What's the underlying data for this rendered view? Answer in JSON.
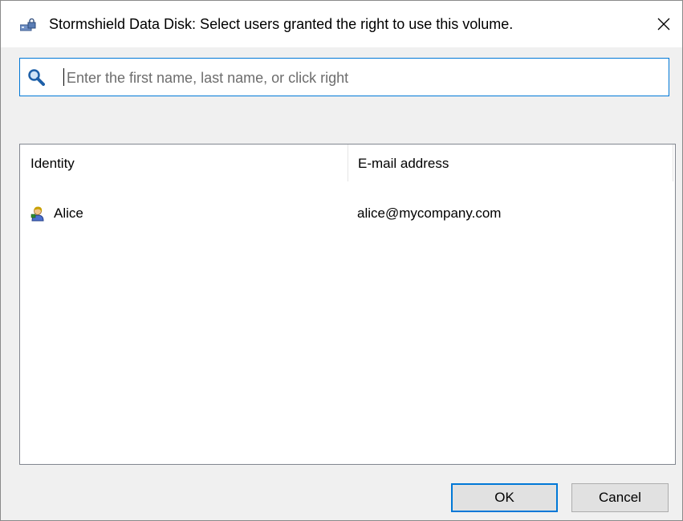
{
  "window": {
    "title": "Stormshield Data Disk: Select users granted the right to use this volume."
  },
  "search": {
    "placeholder": "Enter the first name, last name, or click right",
    "value": ""
  },
  "list": {
    "columns": [
      "Identity",
      "E-mail address"
    ],
    "rows": [
      {
        "identity": "Alice",
        "email": "alice@mycompany.com",
        "icon": "user-icon"
      }
    ]
  },
  "buttons": {
    "ok": "OK",
    "cancel": "Cancel"
  },
  "colors": {
    "accent": "#0078d7",
    "dialog_background": "#f0f0f0"
  }
}
